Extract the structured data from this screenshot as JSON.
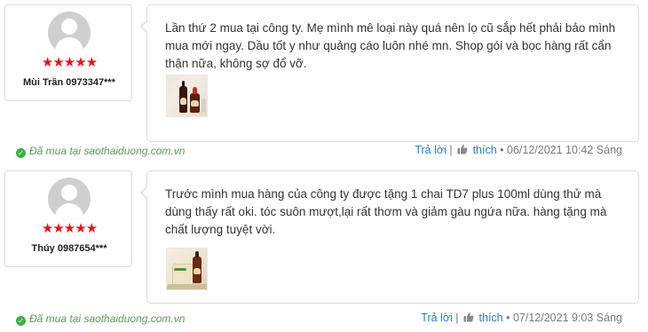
{
  "reviews": [
    {
      "user": "Mùi Trần 0973347***",
      "stars": "★★★★★",
      "rating": 5,
      "text": "Lần thứ 2 mua tại công ty. Mẹ mình mê loại này quá nên lọ cũ sắp hết phải bảo mình mua mới ngay. Dầu tốt y như quảng cáo luôn nhé mn. Shop gói và bọc hàng rất cẩn thận nữa, không sợ đổ vỡ.",
      "verified": "Đã mua tại saothaiduong.com.vn",
      "reply": "Trả lời",
      "like": "thích",
      "timestamp": "• 06/12/2021 10:42 Sáng"
    },
    {
      "user": "Thúy 0987654***",
      "stars": "★★★★★",
      "rating": 5,
      "text": "Trước mình mua hàng của công ty được tặng 1 chai TD7 plus 100ml dùng thử mà dùng thấy rất oki. tóc suôn mượt,lại rất thơm và giảm gàu ngứa nữa. hàng tặng mà chất lượng tuyệt vời.",
      "verified": "Đã mua tại saothaiduong.com.vn",
      "reply": "Trả lời",
      "like": "thích",
      "timestamp": "• 07/12/2021 9:03 Sáng"
    }
  ],
  "colors": {
    "star": "#e4161a",
    "link": "#2a79c9",
    "verified": "#5a9a5a"
  },
  "icons": {
    "like": "thumbs-up-icon",
    "verified": "check-circle-icon"
  }
}
